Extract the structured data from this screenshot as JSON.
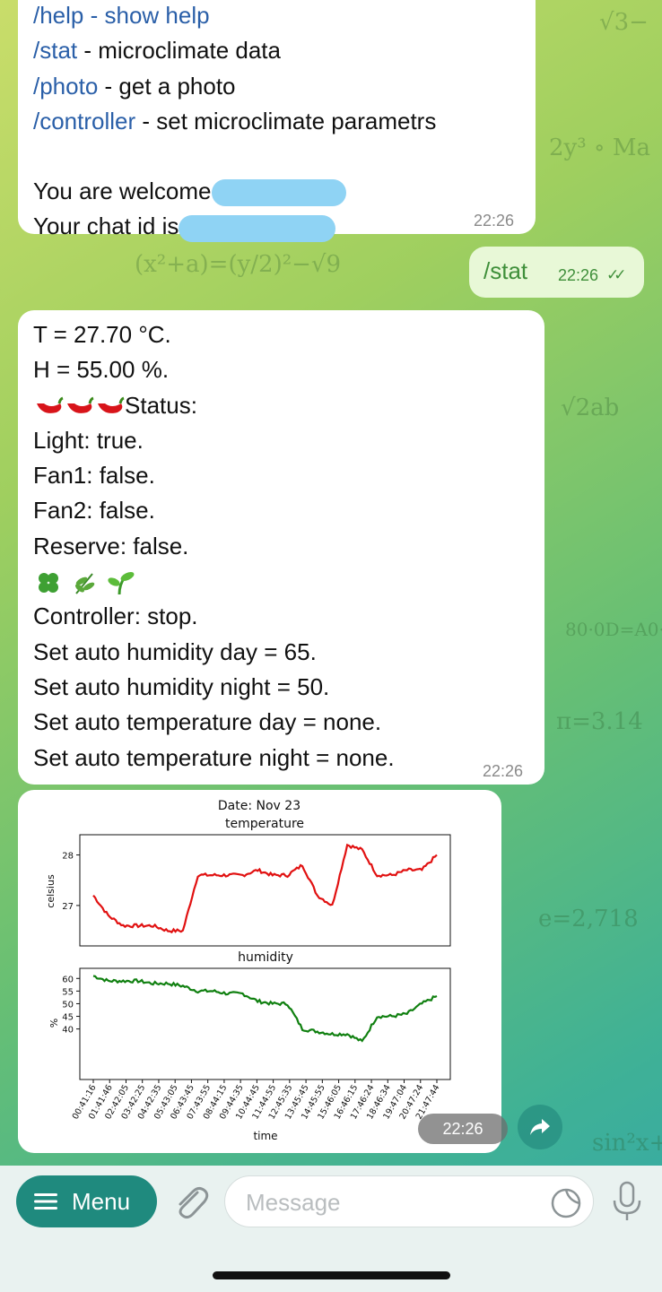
{
  "help_bubble": {
    "cutoff_line": "/help - show help",
    "commands": [
      {
        "cmd": "/stat",
        "desc": " - microclimate data"
      },
      {
        "cmd": "/photo",
        "desc": " - get a photo"
      },
      {
        "cmd": "/controller",
        "desc": " - set microclimate parametrs"
      }
    ],
    "welcome": "You are welcome",
    "chat_id": "Your chat id is",
    "time": "22:26"
  },
  "outgoing": {
    "text": "/stat",
    "time": "22:26"
  },
  "stat_bubble": {
    "lines_top": [
      "T = 27.70 °C.",
      "H = 55.00 %."
    ],
    "status_label": "Status:",
    "status_lines": [
      "Light: true.",
      "Fan1: false.",
      "Fan2: false.",
      "Reserve: false."
    ],
    "lines_bottom": [
      "Controller: stop.",
      "Set auto humidity day = 65.",
      "Set auto humidity night = 50.",
      "Set auto temperature day = none.",
      "Set auto temperature night = none."
    ],
    "time": "22:26"
  },
  "photo_time": "22:26",
  "chart_data": [
    {
      "type": "line",
      "title": "Date: Nov 23",
      "subtitle": "temperature",
      "ylabel": "celsius",
      "yticks": [
        27,
        28
      ],
      "ylim": [
        26.2,
        28.4
      ],
      "color": "#e11111",
      "x": [
        "00:41:16",
        "01:41:46",
        "02:42:05",
        "03:42:25",
        "04:42:35",
        "05:43:05",
        "06:43:45",
        "07:43:55",
        "08:44:15",
        "09:44:35",
        "10:44:45",
        "11:44:55",
        "12:45:35",
        "13:45:45",
        "14:45:55",
        "15:46:05",
        "16:46:15",
        "17:46:24",
        "18:46:34",
        "19:47:04",
        "20:47:24",
        "21:47:44"
      ],
      "values": [
        27.2,
        26.8,
        26.6,
        26.6,
        26.6,
        26.5,
        26.5,
        27.6,
        27.6,
        27.6,
        27.6,
        27.7,
        27.6,
        27.6,
        27.8,
        27.2,
        27.0,
        28.2,
        28.1,
        27.6,
        27.6,
        27.7,
        27.7,
        28.0
      ]
    },
    {
      "type": "line",
      "title": "humidity",
      "ylabel": "%",
      "xlabel": "time",
      "yticks": [
        40,
        45,
        50,
        55,
        60
      ],
      "ylim": [
        20,
        64
      ],
      "color": "#108010",
      "x": [
        "00:41:16",
        "01:41:46",
        "02:42:05",
        "03:42:25",
        "04:42:35",
        "05:43:05",
        "06:43:45",
        "07:43:55",
        "08:44:15",
        "09:44:35",
        "10:44:45",
        "11:44:55",
        "12:45:35",
        "13:45:45",
        "14:45:55",
        "15:46:05",
        "16:46:15",
        "17:46:24",
        "18:46:34",
        "19:47:04",
        "20:47:24",
        "21:47:44"
      ],
      "values": [
        61,
        59,
        59,
        59,
        58,
        58,
        57,
        55,
        55,
        54,
        54,
        51,
        50,
        50,
        40,
        39,
        38,
        38,
        35,
        45,
        45,
        46,
        50,
        53
      ]
    }
  ],
  "bottom": {
    "menu_label": "Menu",
    "message_placeholder": "Message"
  },
  "icons": [
    "chili-icon",
    "clover-icon",
    "herb-icon",
    "seedling-icon",
    "check-icon",
    "share-icon",
    "menu-icon",
    "paperclip-icon",
    "sticker-icon",
    "mic-icon"
  ]
}
